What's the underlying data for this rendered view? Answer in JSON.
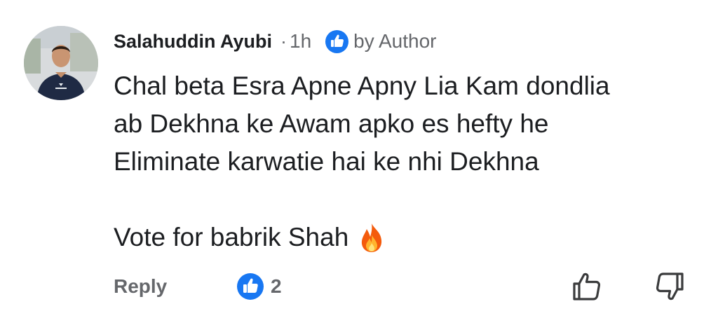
{
  "comment": {
    "author_name": "Salahuddin Ayubi",
    "separator": "·",
    "time": "1h",
    "badge_icon": "thumbs-up-badge-icon",
    "badge_label": "by Author",
    "text_lines": [
      "Chal beta Esra Apne Apny Lia Kam dondlia",
      "ab Dekhna ke Awam apko es hefty he",
      "Eliminate karwatie hai ke nhi Dekhna"
    ],
    "vote_text": "Vote for babrik Shah",
    "emoji": "fire-icon"
  },
  "footer": {
    "reply_label": "Reply",
    "reaction_icon": "like-reaction-icon",
    "reaction_count": "2",
    "like_icon": "thumbs-up-outline-icon",
    "dislike_icon": "thumbs-down-outline-icon"
  },
  "colors": {
    "primary_text": "#1c1e21",
    "secondary_text": "#65676b",
    "accent_blue": "#1877f2"
  }
}
